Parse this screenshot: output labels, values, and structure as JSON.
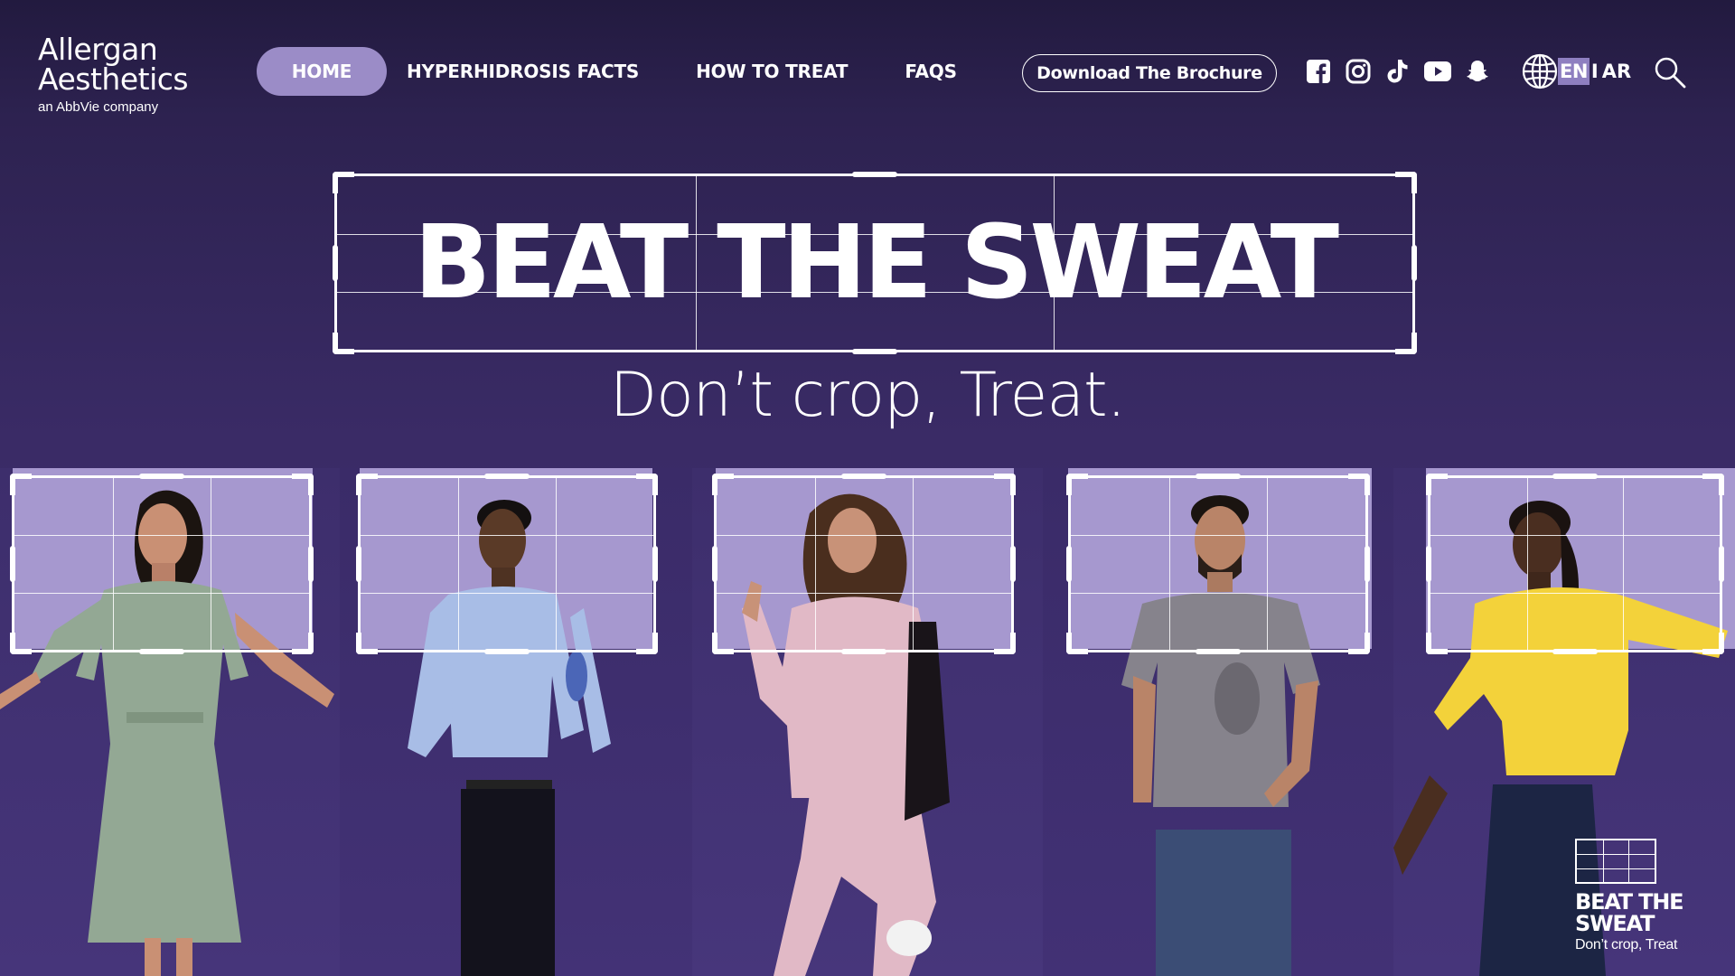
{
  "logo": {
    "line1": "Allergan",
    "line2": "Aesthetics",
    "tagline": "an AbbVie company"
  },
  "nav": {
    "items": [
      {
        "label": "HOME",
        "active": true
      },
      {
        "label": "HYPERHIDROSIS FACTS",
        "active": false
      },
      {
        "label": "HOW TO TREAT",
        "active": false
      },
      {
        "label": "FAQS",
        "active": false
      }
    ]
  },
  "brochure_button": "Download The Brochure",
  "social": [
    "facebook-icon",
    "instagram-icon",
    "tiktok-icon",
    "youtube-icon",
    "snapchat-icon"
  ],
  "language": {
    "icon": "globe-icon",
    "current": "EN",
    "separator": "I",
    "other": "AR"
  },
  "search_icon": "search-icon",
  "hero": {
    "title": "BEAT THE SWEAT",
    "subtitle": "Don’t crop, Treat."
  },
  "badge": {
    "title_line1": "BEAT THE",
    "title_line2": "SWEAT",
    "subtitle": "Don’t crop, Treat"
  },
  "colors": {
    "background": "#2d2250",
    "accent": "#9b8cc7",
    "highlight": "#a698cf",
    "text": "#ffffff"
  }
}
